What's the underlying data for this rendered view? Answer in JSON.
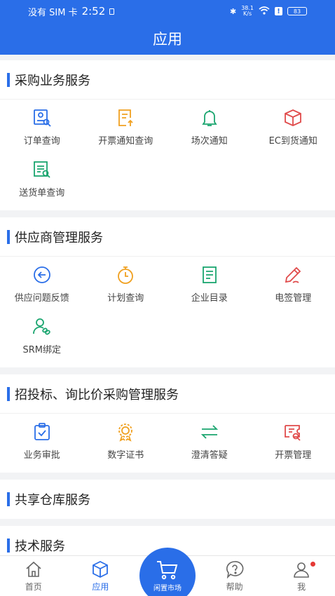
{
  "status": {
    "carrier": "没有 SIM 卡",
    "time": "2:52",
    "net_speed_value": "38.1",
    "net_speed_unit": "K/s",
    "battery": "83"
  },
  "header": {
    "title": "应用"
  },
  "sections": [
    {
      "title": "采购业务服务",
      "items": [
        {
          "label": "订单查询",
          "icon": "order-search-icon",
          "color": "#2a6ee8"
        },
        {
          "label": "开票通知查询",
          "icon": "invoice-notice-icon",
          "color": "#f0a020"
        },
        {
          "label": "场次通知",
          "icon": "bell-icon",
          "color": "#1aa56f"
        },
        {
          "label": "EC到货通知",
          "icon": "box-icon",
          "color": "#e04b4b"
        },
        {
          "label": "送货单查询",
          "icon": "delivery-doc-icon",
          "color": "#1aa56f"
        }
      ]
    },
    {
      "title": "供应商管理服务",
      "items": [
        {
          "label": "供应问题反馈",
          "icon": "back-arrow-circle-icon",
          "color": "#2a6ee8"
        },
        {
          "label": "计划查询",
          "icon": "timer-icon",
          "color": "#f0a020"
        },
        {
          "label": "企业目录",
          "icon": "document-list-icon",
          "color": "#1aa56f"
        },
        {
          "label": "电签管理",
          "icon": "pen-icon",
          "color": "#e04b4b"
        },
        {
          "label": "SRM绑定",
          "icon": "user-link-icon",
          "color": "#1aa56f"
        }
      ]
    },
    {
      "title": "招投标、询比价采购管理服务",
      "items": [
        {
          "label": "业务审批",
          "icon": "clipboard-check-icon",
          "color": "#2a6ee8"
        },
        {
          "label": "数字证书",
          "icon": "certificate-icon",
          "color": "#f0a020"
        },
        {
          "label": "澄清答疑",
          "icon": "swap-arrows-icon",
          "color": "#1aa56f"
        },
        {
          "label": "开票管理",
          "icon": "ticket-search-icon",
          "color": "#e04b4b"
        }
      ]
    },
    {
      "title": "共享仓库服务",
      "items": []
    },
    {
      "title": "技术服务",
      "items": []
    }
  ],
  "tabbar": {
    "tabs": [
      {
        "label": "首页",
        "icon": "home-icon"
      },
      {
        "label": "应用",
        "icon": "cube-icon"
      },
      {
        "label": "闲置市场",
        "icon": "cart-icon"
      },
      {
        "label": "帮助",
        "icon": "help-icon"
      },
      {
        "label": "我",
        "icon": "person-icon"
      }
    ]
  },
  "colors": {
    "primary": "#2a6ee8",
    "badge": "#e53935"
  }
}
